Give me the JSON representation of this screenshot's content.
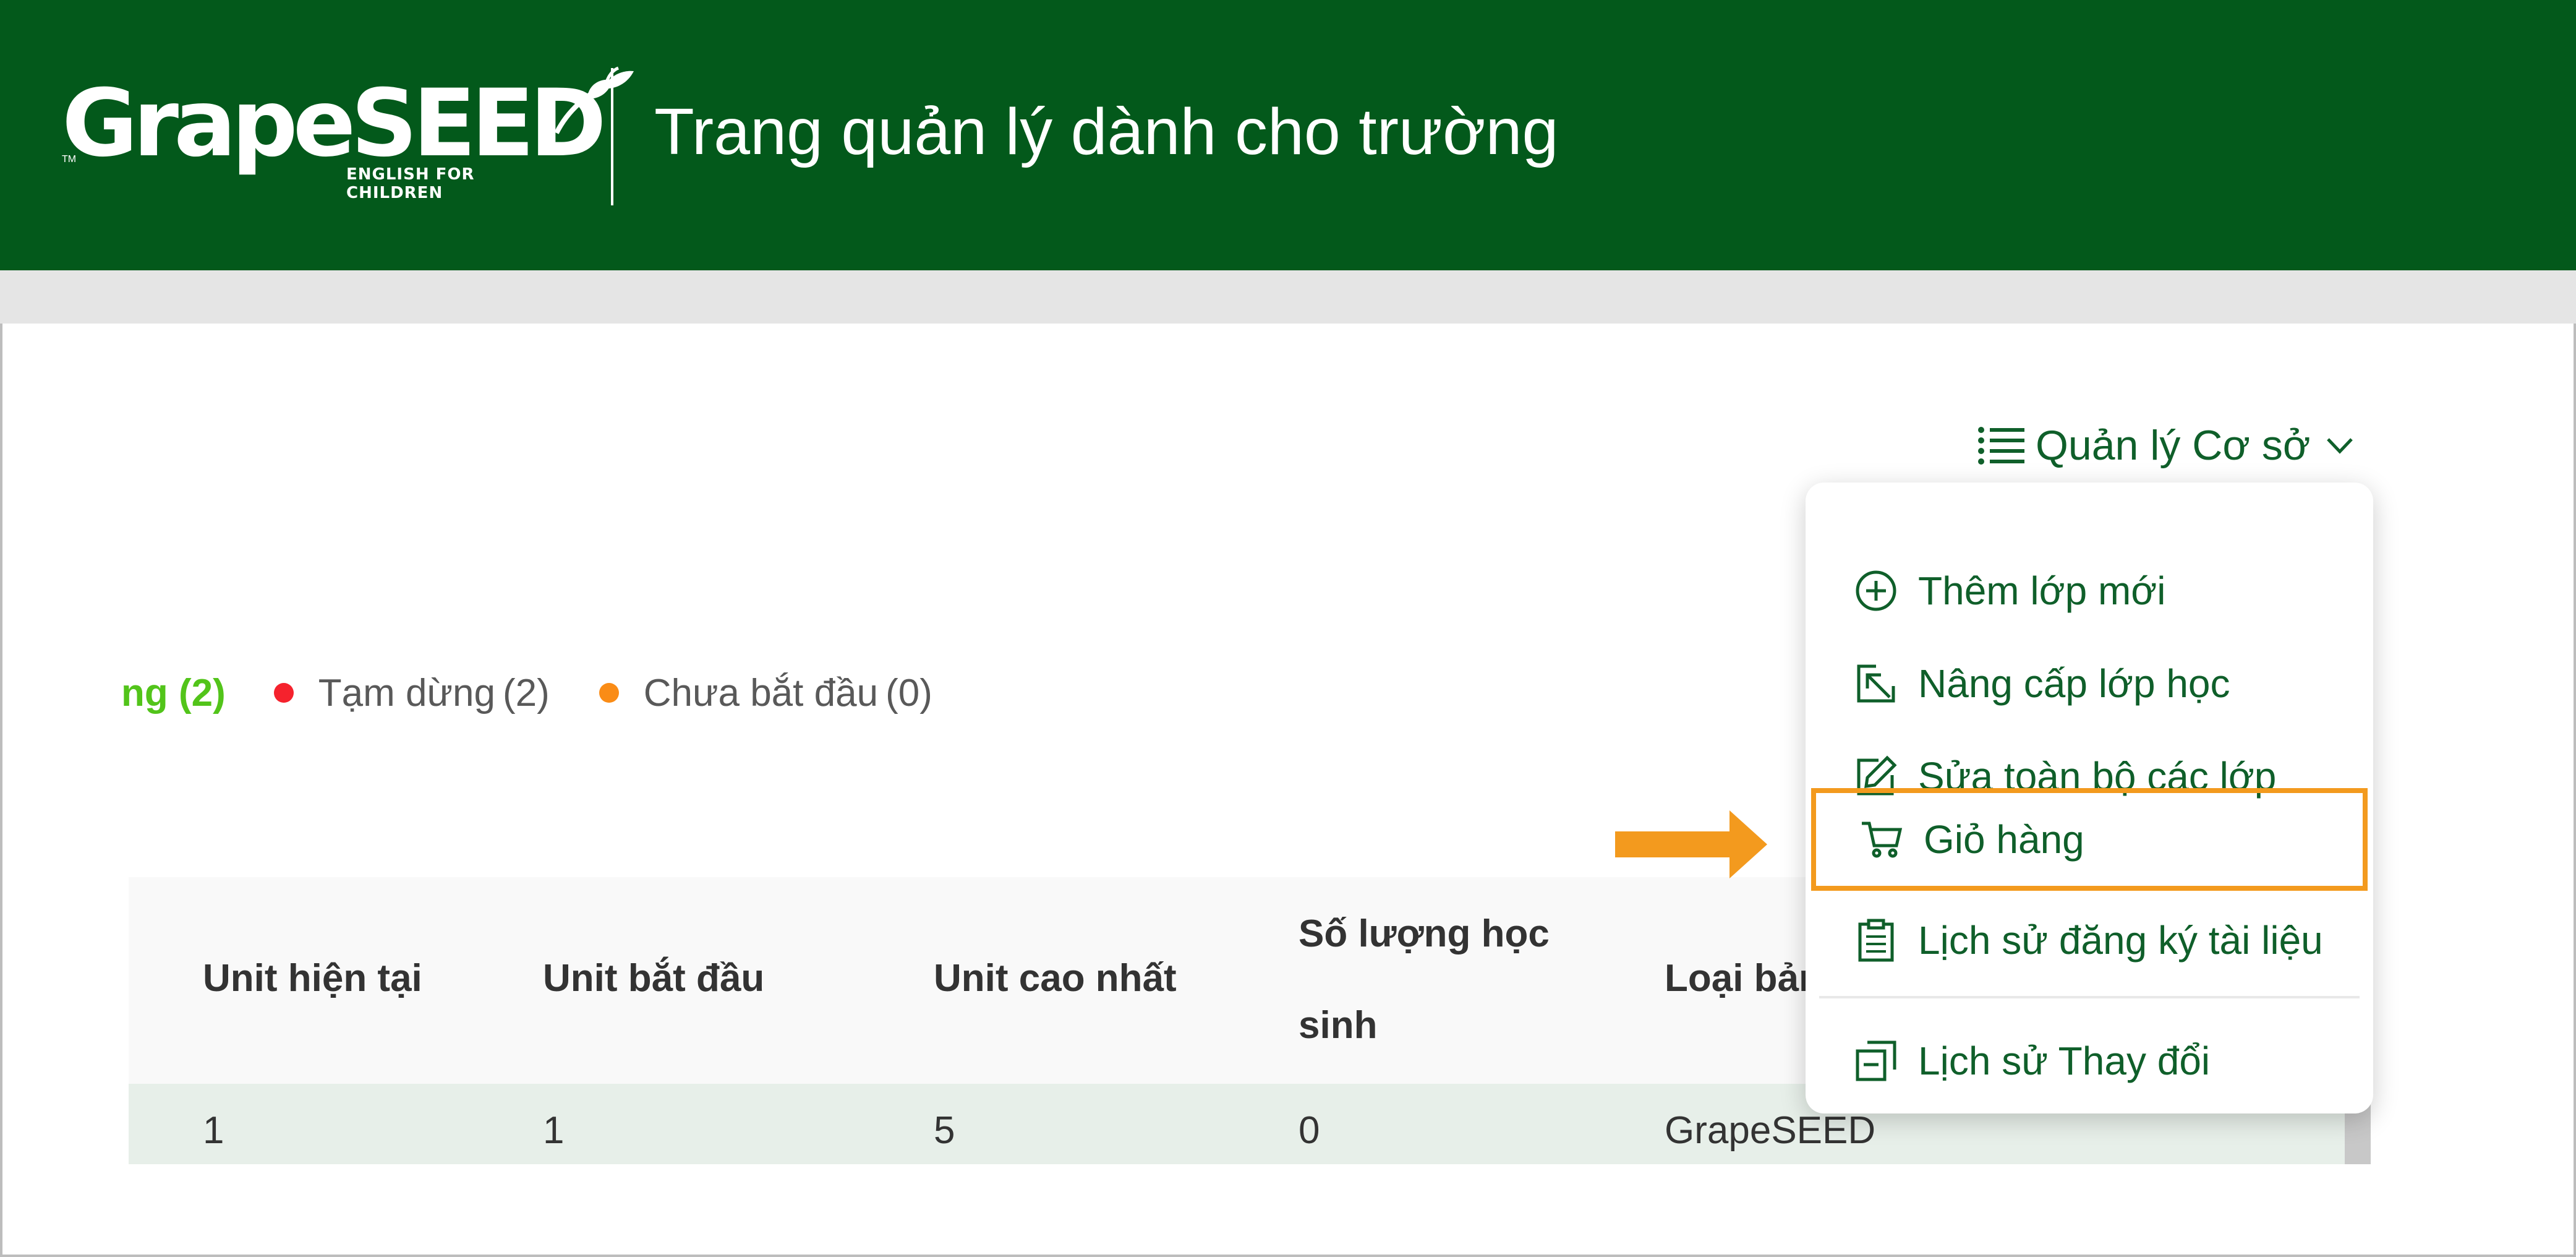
{
  "header": {
    "logo_text": "GrapeSEED",
    "logo_tagline": "ENGLISH FOR CHILDREN",
    "logo_tm": "TM",
    "title": "Trang quản lý dành cho trường"
  },
  "manage_menu": {
    "label": "Quản lý Cơ sở",
    "icon": "list-icon",
    "items": [
      {
        "label": "Thêm lớp mới",
        "icon": "plus-circle-icon"
      },
      {
        "label": "Nâng cấp lớp học",
        "icon": "upgrade-arrow-icon"
      },
      {
        "label": "Sửa toàn bộ các lớp",
        "icon": "edit-icon"
      },
      {
        "label": "Giỏ hàng",
        "icon": "cart-icon",
        "highlighted": true
      },
      {
        "label": "Lịch sử đăng ký tài liệu",
        "icon": "clipboard-icon"
      },
      {
        "label": "Lịch sử Thay đổi",
        "icon": "history-icon"
      }
    ]
  },
  "status_legend": {
    "active": {
      "label": "ng",
      "count": "(2)",
      "color": "#52c41a"
    },
    "paused": {
      "label": "Tạm dừng",
      "count": "(2)",
      "color": "#f5222d"
    },
    "not_started": {
      "label": "Chưa bắt đầu",
      "count": "(0)",
      "color": "#fa8c16"
    }
  },
  "table": {
    "headers": [
      "Unit hiện tại",
      "Unit bắt đầu",
      "Unit cao nhất",
      "Số lượng học sinh",
      "Loại bản"
    ],
    "rows": [
      [
        "1",
        "1",
        "5",
        "0",
        "GrapeSEED"
      ]
    ]
  },
  "colors": {
    "header_bg": "#03591b",
    "accent_green": "#0f5f2a",
    "highlight_orange": "#f39a1e"
  }
}
